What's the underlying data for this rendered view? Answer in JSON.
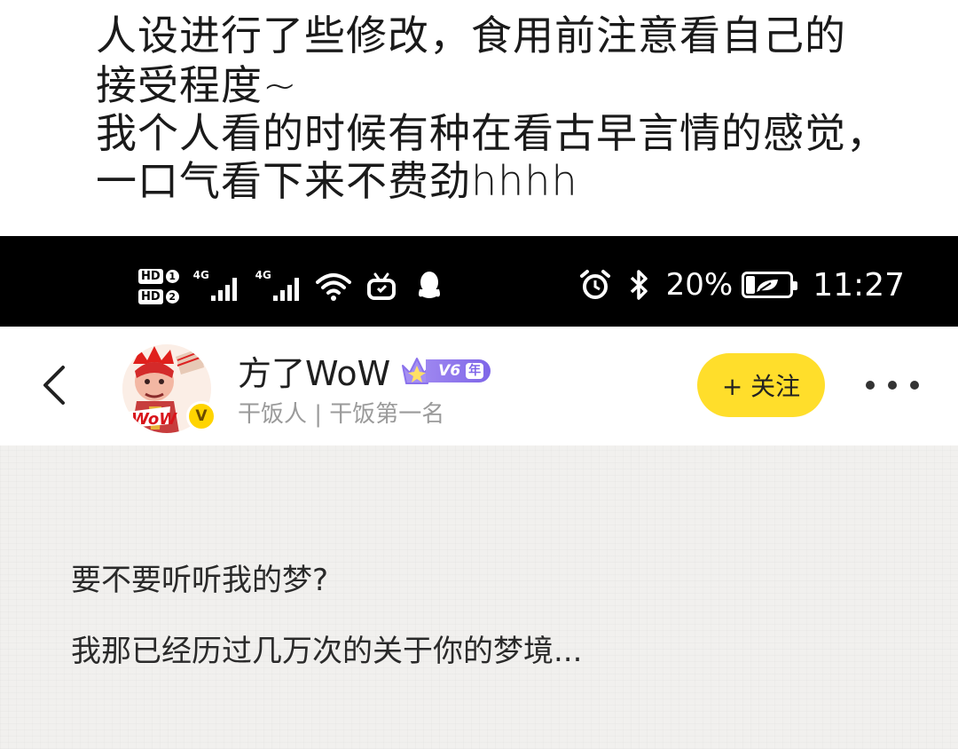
{
  "caption": {
    "lines": [
      "人设进行了些修改，食用前注意看自己的",
      "接受程度~",
      "我个人看的时候有种在看古早言情的感觉，",
      "一口气看下来不费劲hhhh"
    ]
  },
  "status_bar": {
    "sim1_label": "HD",
    "sim1_num": "1",
    "sim2_label": "HD",
    "sim2_num": "2",
    "net1": "4G",
    "net2": "4G",
    "battery_percent_label": "20%",
    "battery_level": 0.2,
    "time": "11:27",
    "icons": [
      "wifi-icon",
      "tv-app-icon",
      "qq-icon",
      "alarm-icon",
      "bluetooth-icon",
      "battery-saver-icon"
    ]
  },
  "profile": {
    "name": "方了WoW",
    "vip_level": "V6",
    "vip_year": "年",
    "verified_mark": "V",
    "subtitle": "干饭人 | 干饭第一名",
    "follow_label": "+ 关注",
    "accent_color": "#ffde2b",
    "vip_color": "#8b72ec"
  },
  "post": {
    "lines": [
      "要不要听听我的梦?",
      "我那已经历过几万次的关于你的梦境..."
    ],
    "background_color": "#f1f0ee"
  }
}
